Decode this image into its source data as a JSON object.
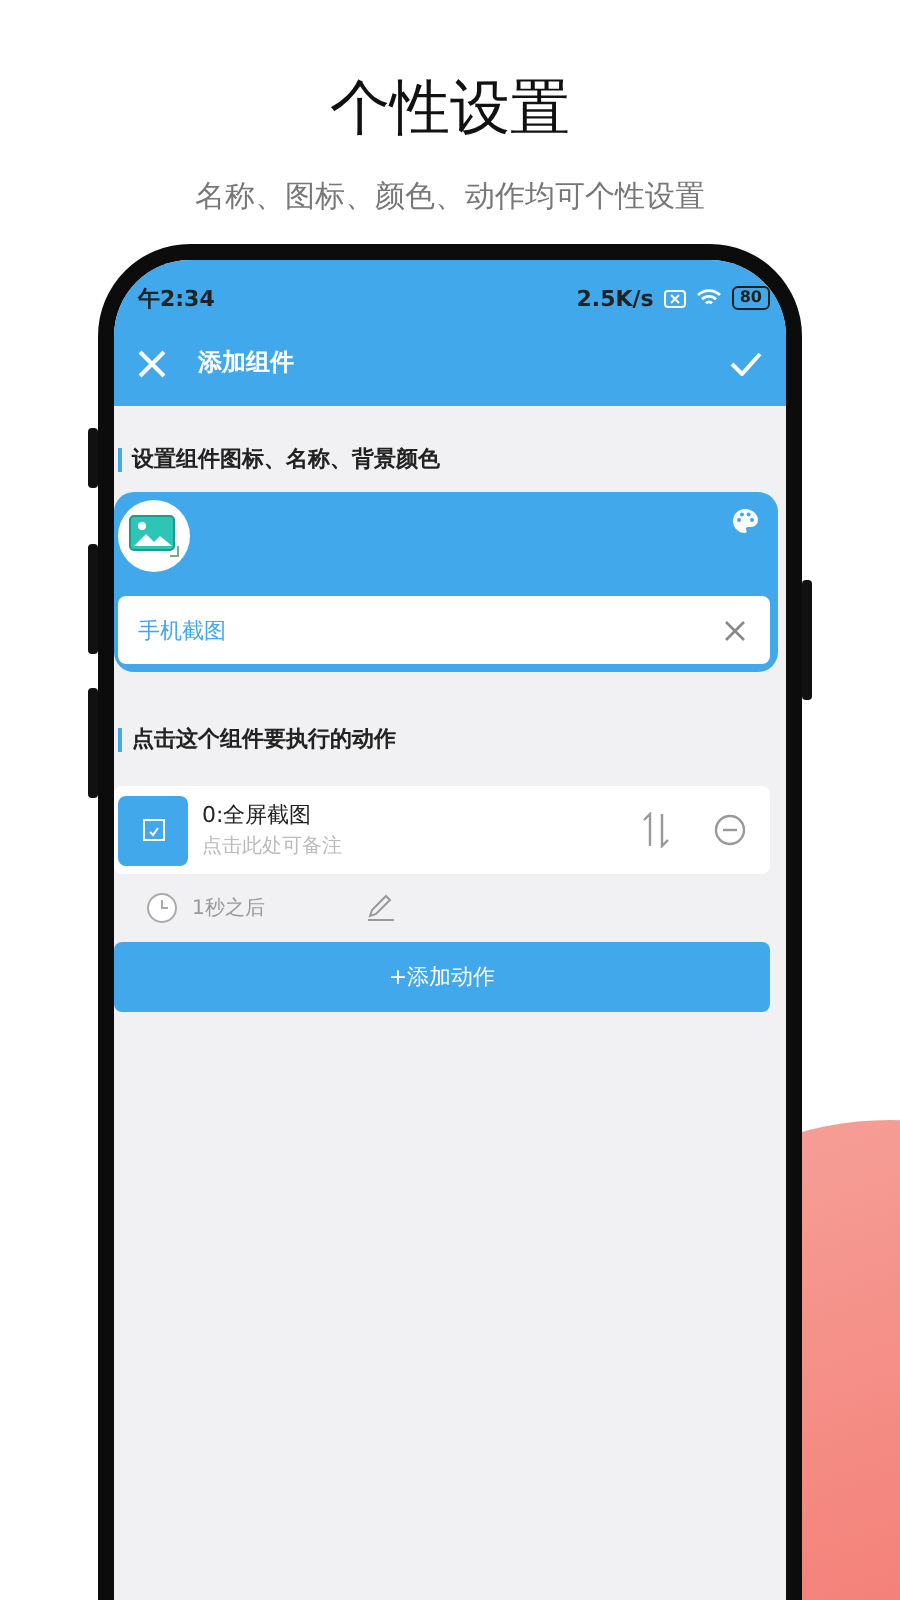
{
  "headline": {
    "title": "个性设置",
    "subtitle": "名称、图标、颜色、动作均可个性设置"
  },
  "status_bar": {
    "time": "午2:34",
    "speed": "2.5K/s",
    "battery": "80"
  },
  "toolbar": {
    "title": "添加组件"
  },
  "widget_section": {
    "heading": "设置组件图标、名称、背景颜色",
    "name_field": {
      "value": "手机截图"
    }
  },
  "action_section": {
    "heading": "点击这个组件要执行的动作",
    "actions": [
      {
        "title": "0:全屏截图",
        "note": "点击此处可备注",
        "delay": "1秒之后"
      }
    ],
    "add_button": "+添加动作"
  }
}
